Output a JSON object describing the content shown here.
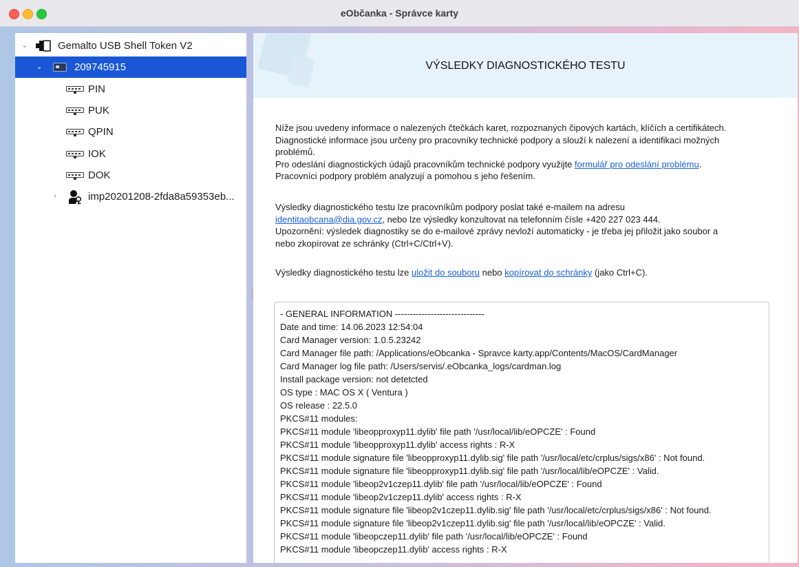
{
  "window": {
    "title": "eObčanka - Správce karty"
  },
  "sidebar": {
    "reader": {
      "label": "Gemalto USB Shell Token V2",
      "icon": "usb-token-icon",
      "expanded": true
    },
    "card": {
      "label": "209745915",
      "icon": "chip-card-icon",
      "expanded": true,
      "selected": true
    },
    "card_items": [
      {
        "label": "PIN",
        "icon": "keypad-icon"
      },
      {
        "label": "PUK",
        "icon": "keypad-icon"
      },
      {
        "label": "QPIN",
        "icon": "keypad-icon"
      },
      {
        "label": "IOK",
        "icon": "keypad-icon"
      },
      {
        "label": "DOK",
        "icon": "keypad-icon"
      }
    ],
    "import_node": {
      "label": "imp20201208-2fda8a59353eb...",
      "icon": "key-user-icon",
      "expanded": false
    }
  },
  "main": {
    "title": "VÝSLEDKY DIAGNOSTICKÉHO TESTU",
    "intro": {
      "line1": "Níže jsou uvedeny informace o nalezených čtečkách karet, rozpoznaných čipových kartách, klíčích a certifikátech.",
      "line2": "Diagnostické informace jsou určeny pro pracovníky technické podpory a slouží k nalezení a identifikaci možných",
      "line3": "problémů.",
      "line4_prefix": "Pro odeslání diagnostických údajů pracovníkům technické podpory využijte ",
      "line4_link": "formulář pro odeslání problému",
      "line4_suffix": ".",
      "line5": "Pracovníci podpory problém analyzují a pomohou s jeho řešením."
    },
    "email": {
      "line1": "Výsledky diagnostického testu lze pracovníkům podpory poslat také e-mailem na adresu",
      "email_link": "identitaobcana@dia.gov.cz",
      "line2_suffix": ", nebo lze výsledky konzultovat na telefonním čísle +420 227 023 444.",
      "line3": "Upozornění: výsledek diagnostiky se do e-mailové zprávy nevloží automaticky - je třeba jej přiložit jako soubor a",
      "line4": "nebo zkopírovat ze schránky (Ctrl+C/Ctrl+V)."
    },
    "save": {
      "prefix": "Výsledky diagnostického testu lze ",
      "save_link": "uložit do souboru",
      "middle": " nebo ",
      "copy_link": "kopírovat do schránky",
      "suffix": " (jako Ctrl+C)."
    },
    "log_lines": [
      "- GENERAL INFORMATION ------------------------------",
      "Date and time: 14.06.2023 12:54:04",
      "Card Manager version: 1.0.5.23242",
      "Card Manager file path: /Applications/eObcanka - Spravce karty.app/Contents/MacOS/CardManager",
      "Card Manager log file path: /Users/servis/.eObcanka_logs/cardman.log",
      "Install package version: not detetcted",
      "OS type : MAC OS X ( Ventura )",
      "OS release : 22.5.0",
      "PKCS#11 modules:",
      "PKCS#11 module 'libeopproxyp11.dylib' file path '/usr/local/lib/eOPCZE' : Found",
      "PKCS#11 module 'libeopproxyp11.dylib' access rights : R-X",
      "PKCS#11 module signature file 'libeopproxyp11.dylib.sig' file path '/usr/local/etc/crplus/sigs/x86' : Not found.",
      "PKCS#11 module signature file 'libeopproxyp11.dylib.sig' file path '/usr/local/lib/eOPCZE' : Valid.",
      "PKCS#11 module 'libeop2v1czep11.dylib' file path '/usr/local/lib/eOPCZE' : Found",
      "PKCS#11 module 'libeop2v1czep11.dylib' access rights : R-X",
      "PKCS#11 module signature file 'libeop2v1czep11.dylib.sig' file path '/usr/local/etc/crplus/sigs/x86' : Not found.",
      "PKCS#11 module signature file 'libeop2v1czep11.dylib.sig' file path '/usr/local/lib/eOPCZE' : Valid.",
      "PKCS#11 module 'libeopczep11.dylib' file path '/usr/local/lib/eOPCZE' : Found",
      "PKCS#11 module 'libeopczep11.dylib' access rights : R-X"
    ]
  },
  "colors": {
    "selection": "#1957d6",
    "link": "#1a5fd6",
    "header_band": "#e7f3fb"
  }
}
